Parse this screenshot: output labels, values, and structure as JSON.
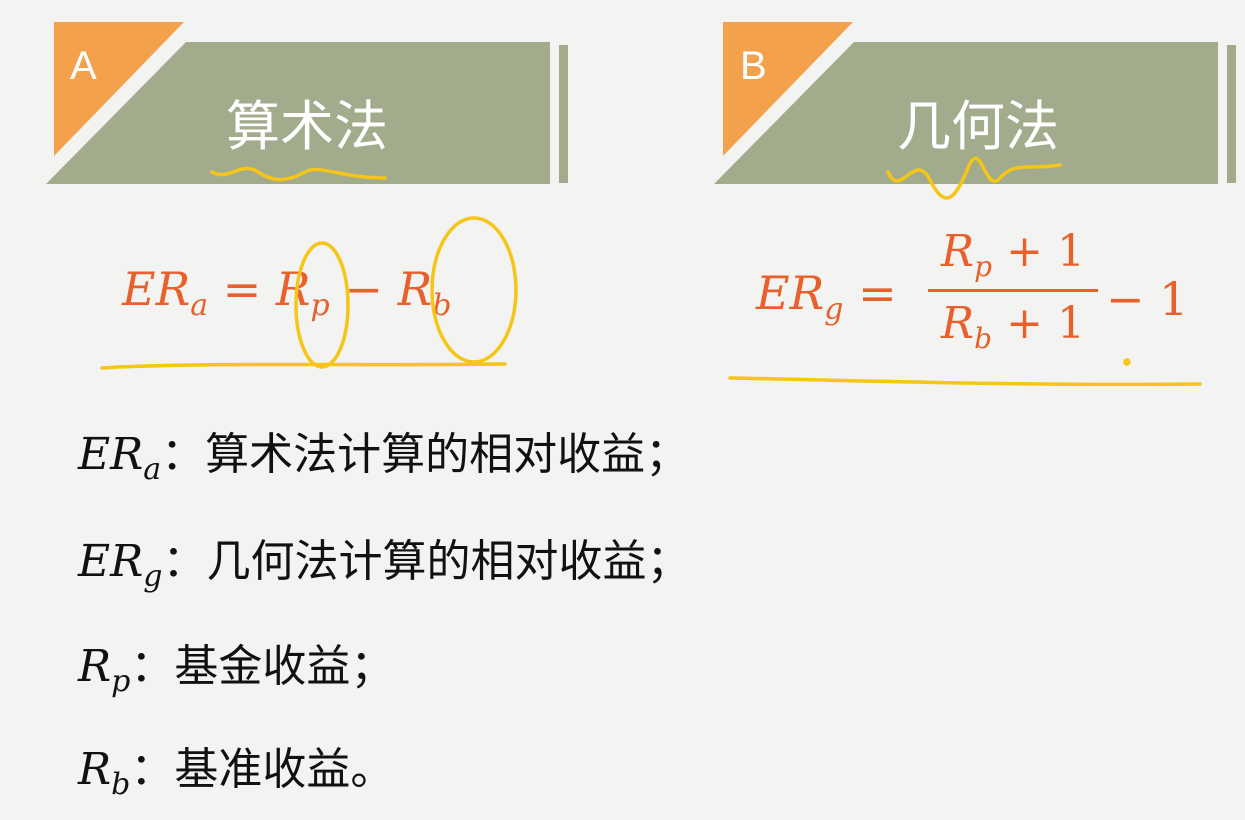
{
  "sections": [
    {
      "letter": "A",
      "title": "算术法"
    },
    {
      "letter": "B",
      "title": "几何法"
    }
  ],
  "formula_a": {
    "lhs": "ER",
    "lhs_sub": "a",
    "eq": "=",
    "t1": "R",
    "t1_sub": "p",
    "op": "−",
    "t2": "R",
    "t2_sub": "b"
  },
  "formula_b": {
    "lhs": "ER",
    "lhs_sub": "g",
    "eq": "=",
    "num": "R",
    "num_sub": "p",
    "num_rest": " + 1",
    "den": "R",
    "den_sub": "b",
    "den_rest": " + 1",
    "tail": "− 1"
  },
  "definitions": [
    {
      "sym": "ER",
      "sub": "a",
      "text": "：算术法计算的相对收益；"
    },
    {
      "sym": "ER",
      "sub": "g",
      "text": "：几何法计算的相对收益；"
    },
    {
      "sym": "R",
      "sub": "p",
      "text": "：基金收益；"
    },
    {
      "sym": "R",
      "sub": "b",
      "text": "：基准收益。"
    }
  ],
  "colors": {
    "banner": "#a3ab8d",
    "corner": "#f3a24b",
    "formula": "#e8612c",
    "annotation": "#f5c518"
  }
}
